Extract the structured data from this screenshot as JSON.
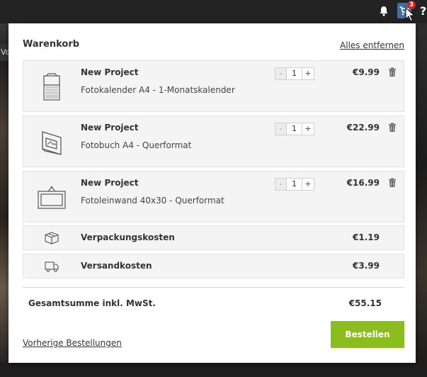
{
  "background": {
    "nav_fragment": "Vo"
  },
  "topbar": {
    "cart_count": "3",
    "help_label": "?"
  },
  "cart": {
    "title": "Warenkorb",
    "remove_all": "Alles entfernen",
    "items": [
      {
        "name": "New Project",
        "description": "Fotokalender A4 - 1-Monatskalender",
        "quantity": "1",
        "price": "€9.99",
        "icon": "calendar-icon",
        "minus": "-",
        "plus": "+"
      },
      {
        "name": "New Project",
        "description": "Fotobuch A4 - Querformat",
        "quantity": "1",
        "price": "€22.99",
        "icon": "photobook-icon",
        "minus": "-",
        "plus": "+"
      },
      {
        "name": "New Project",
        "description": "Fotoleinwand 40x30 - Querformat",
        "quantity": "1",
        "price": "€16.99",
        "icon": "canvas-icon",
        "minus": "-",
        "plus": "+"
      }
    ],
    "packaging": {
      "label": "Verpackungskosten",
      "value": "€1.19",
      "icon": "box-icon"
    },
    "shipping": {
      "label": "Versandkosten",
      "value": "€3.99",
      "icon": "truck-icon"
    },
    "total": {
      "label": "Gesamtsumme inkl. MwSt.",
      "value": "€55.15"
    },
    "previous_orders": "Vorherige Bestellungen",
    "order_button": "Bestellen"
  },
  "colors": {
    "order_button": "#8cbd1f",
    "cart_button": "#3e6fa6",
    "badge": "#d02020"
  }
}
